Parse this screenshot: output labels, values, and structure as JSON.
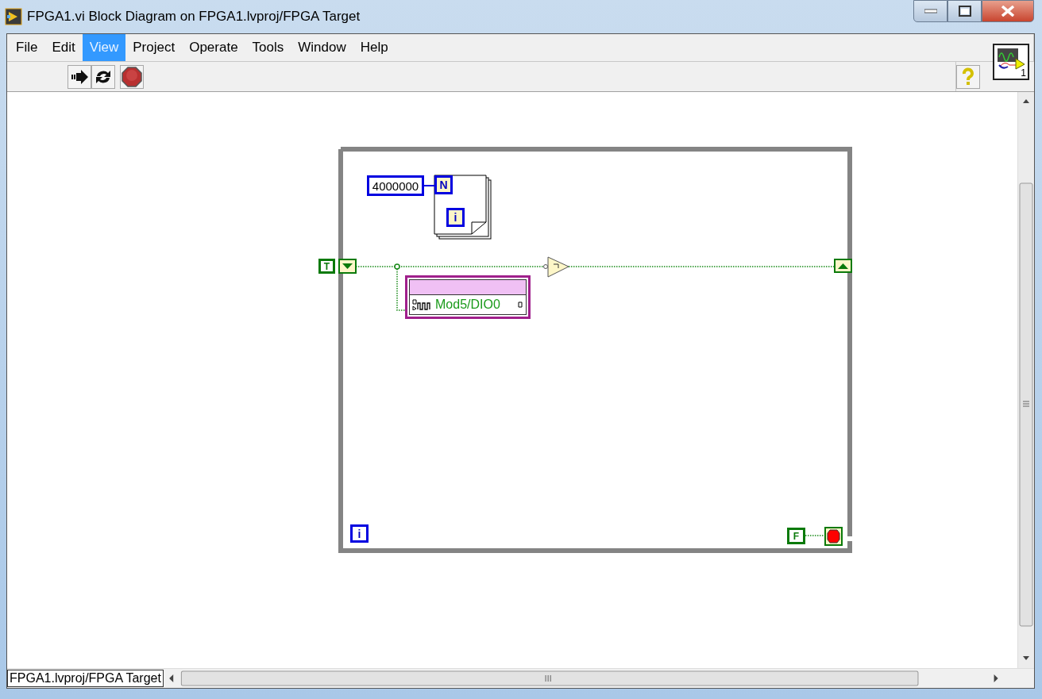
{
  "window": {
    "title": "FPGA1.vi Block Diagram on FPGA1.lvproj/FPGA Target"
  },
  "menu": [
    {
      "label": "File",
      "selected": false
    },
    {
      "label": "Edit",
      "selected": false
    },
    {
      "label": "View",
      "selected": true
    },
    {
      "label": "Project",
      "selected": false
    },
    {
      "label": "Operate",
      "selected": false
    },
    {
      "label": "Tools",
      "selected": false
    },
    {
      "label": "Window",
      "selected": false
    },
    {
      "label": "Help",
      "selected": false
    }
  ],
  "vi_icon": {
    "number": "1"
  },
  "diagram": {
    "count_constant": "4000000",
    "for_loop": {
      "count_terminal": "N",
      "iteration_terminal": "i"
    },
    "true_constant": "T",
    "io_node": {
      "label": "Mod5/DIO0"
    },
    "while_loop": {
      "iteration_terminal": "i",
      "false_constant": "F"
    }
  },
  "status_bar": {
    "context": "FPGA1.lvproj/FPGA Target"
  }
}
